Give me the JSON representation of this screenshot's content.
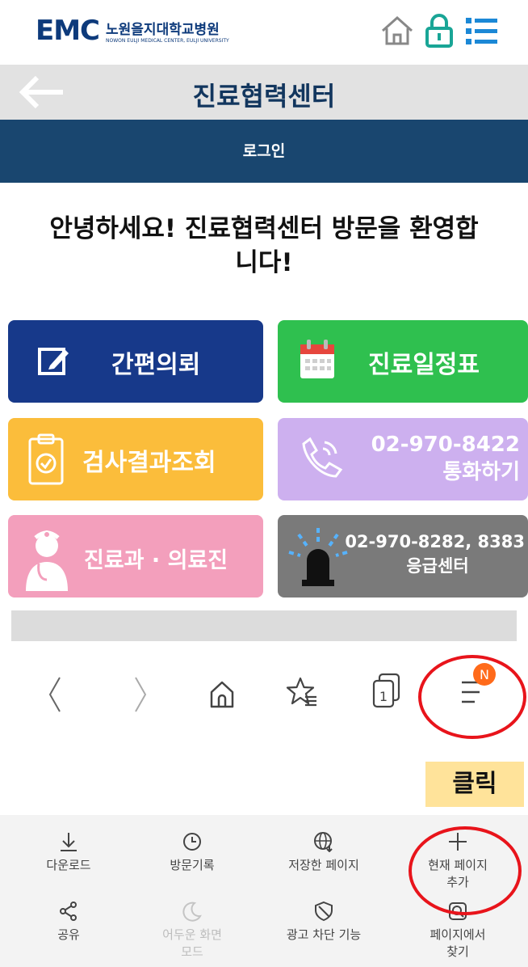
{
  "header": {
    "logo_brand": "EMC",
    "logo_name_kr": "노원을지대학교병원",
    "logo_name_en": "NOWON EULJI MEDICAL CENTER, EULJI UNIVERSITY",
    "icons": [
      "home-icon",
      "lock-icon",
      "list-menu-icon"
    ]
  },
  "titlebar": {
    "title": "진료협력센터",
    "back_icon": "back-arrow-icon"
  },
  "loginbar": {
    "label": "로그인"
  },
  "welcome": {
    "line1": "안녕하세요! 진료협력센터 방문을 환영합",
    "line2": "니다!"
  },
  "tiles": [
    {
      "label": "간편의뢰",
      "icon": "edit-icon",
      "color": "#17398a"
    },
    {
      "label": "진료일정표",
      "icon": "calendar-icon",
      "color": "#2fc04f"
    },
    {
      "label": "검사결과조회",
      "icon": "clipboard-check-icon",
      "color": "#fbbd3b"
    },
    {
      "label_line1": "02-970-8422",
      "label_line2": "통화하기",
      "icon": "phone-icon",
      "color": "#cdb0ef"
    },
    {
      "label": "진료과 · 의료진",
      "icon": "doctor-icon",
      "color": "#f39fbc"
    },
    {
      "label_line1": "02-970-8282, 8383",
      "label_line2": "응급센터",
      "icon": "siren-icon",
      "color": "#7a7a7a"
    }
  ],
  "browser_nav": {
    "icons": [
      "back-icon",
      "forward-icon",
      "home-icon",
      "bookmark-icon",
      "tabs-icon",
      "menu-icon"
    ],
    "tab_count": "1",
    "menu_badge": "N"
  },
  "annotation": {
    "click_label": "클릭",
    "highlight_color": "#e8141b"
  },
  "menu": {
    "items": [
      {
        "label": "다운로드",
        "icon": "download-icon",
        "enabled": true
      },
      {
        "label": "방문기록",
        "icon": "history-icon",
        "enabled": true
      },
      {
        "label": "저장한 페이지",
        "icon": "saved-pages-icon",
        "enabled": true
      },
      {
        "label_line1": "현재 페이지",
        "label_line2": "추가",
        "icon": "add-icon",
        "enabled": true
      },
      {
        "label": "공유",
        "icon": "share-icon",
        "enabled": true
      },
      {
        "label_line1": "어두운 화면",
        "label_line2": "모드",
        "icon": "dark-mode-icon",
        "enabled": false
      },
      {
        "label": "광고 차단 기능",
        "icon": "ad-block-icon",
        "enabled": true
      },
      {
        "label_line1": "페이지에서",
        "label_line2": "찾기",
        "icon": "find-in-page-icon",
        "enabled": true
      }
    ]
  }
}
